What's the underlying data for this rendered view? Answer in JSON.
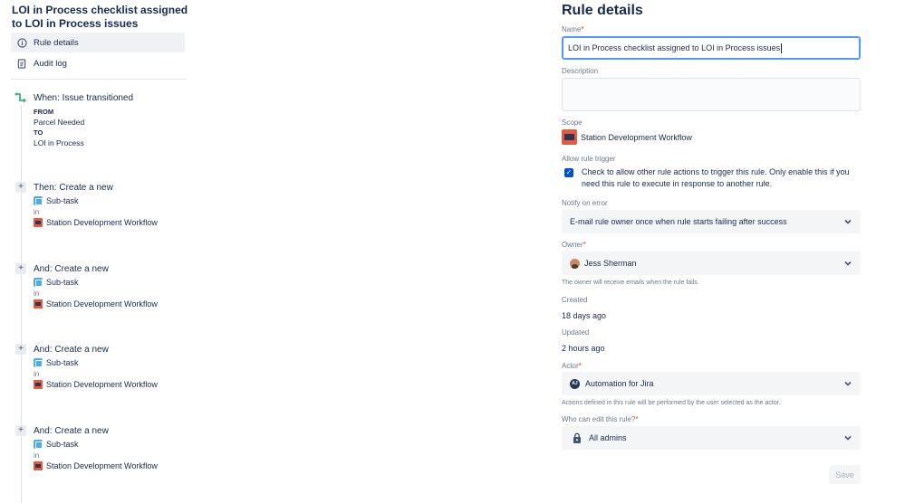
{
  "left": {
    "rule_title": "LOI in Process checklist assigned to LOI in Process issues",
    "nav": [
      {
        "label": "Rule details",
        "icon": "info-icon"
      },
      {
        "label": "Audit log",
        "icon": "document-icon"
      }
    ],
    "trigger": {
      "title": "When: Issue transitioned",
      "from_label": "FROM",
      "from_value": "Parcel Needed",
      "to_label": "TO",
      "to_value": "LOI in Process"
    },
    "actions": [
      {
        "title": "Then: Create a new",
        "issue_type": "Sub-task",
        "in_label": "in",
        "project": "Station Development Workflow"
      },
      {
        "title": "And: Create a new",
        "issue_type": "Sub-task",
        "in_label": "in",
        "project": "Station Development Workflow"
      },
      {
        "title": "And: Create a new",
        "issue_type": "Sub-task",
        "in_label": "in",
        "project": "Station Development Workflow"
      },
      {
        "title": "And: Create a new",
        "issue_type": "Sub-task",
        "in_label": "in",
        "project": "Station Development Workflow"
      }
    ],
    "plus_symbol": "+"
  },
  "right": {
    "heading": "Rule details",
    "name_label": "Name",
    "required_mark": "*",
    "name_value": "LOI in Process checklist assigned to LOI in Process issues",
    "description_label": "Description",
    "scope_label": "Scope",
    "scope_value": "Station Development Workflow",
    "allow_trigger_label": "Allow rule trigger",
    "allow_trigger_text": "Check to allow other rule actions to trigger this rule. Only enable this if you need this rule to execute in response to another rule.",
    "allow_trigger_checked": true,
    "notify_label": "Notify on error",
    "notify_value": "E-mail rule owner once when rule starts failing after success",
    "owner_label": "Owner",
    "owner_value": "Jess Sherman",
    "owner_help": "The owner will receive emails when the rule fails.",
    "created_label": "Created",
    "created_value": "18 days ago",
    "updated_label": "Updated",
    "updated_value": "2 hours ago",
    "actor_label": "Actor",
    "actor_value": "Automation for Jira",
    "actor_badge": "AJ",
    "actor_help": "Actions defined in this rule will be performed by the user selected as the actor.",
    "edit_label": "Who can edit this rule?",
    "edit_value": "All admins",
    "save_label": "Save"
  },
  "colors": {
    "accent": "#0052cc",
    "focus": "#4c9aff",
    "project": "#e5593e",
    "subtask": "#4bade8",
    "required": "#de350b"
  }
}
